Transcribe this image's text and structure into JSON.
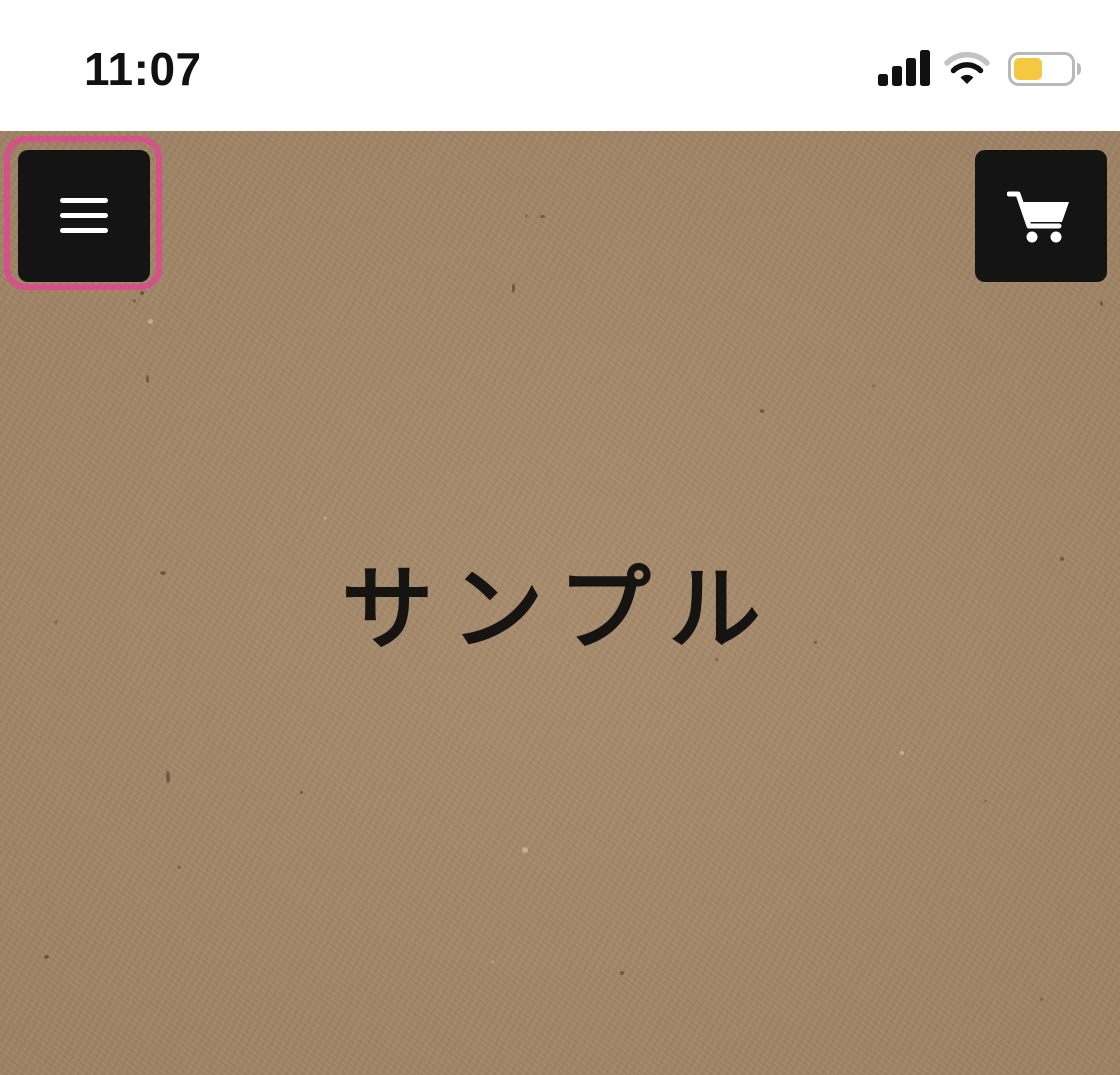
{
  "status_bar": {
    "time": "11:07",
    "signal_icon": "cellular-signal-icon",
    "wifi_icon": "wifi-icon",
    "battery_icon": "battery-icon",
    "battery_level": 0.5,
    "battery_color": "#f5c842"
  },
  "header": {
    "menu_icon": "hamburger-menu-icon",
    "cart_icon": "shopping-cart-icon",
    "button_color": "#141414",
    "highlight_color": "#d6508a"
  },
  "hero": {
    "title": "サンプル",
    "background_color": "#a28667"
  }
}
